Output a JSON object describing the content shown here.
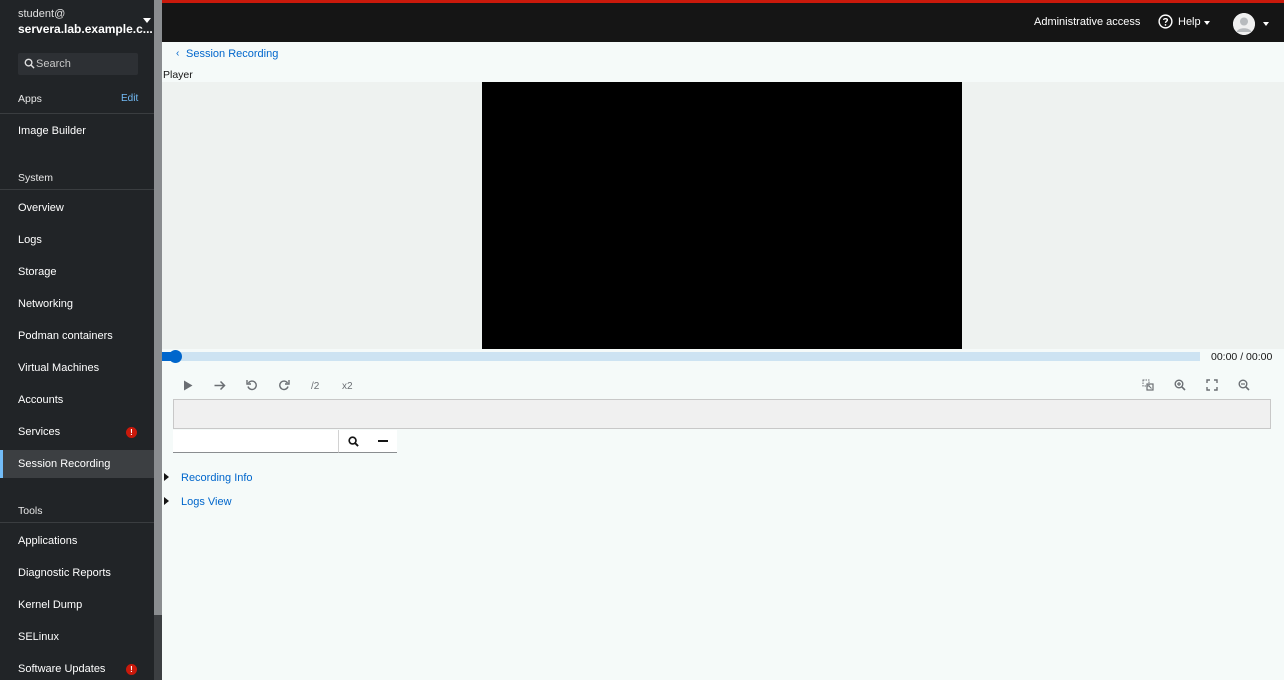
{
  "host": {
    "user": "student@",
    "name": "servera.lab.example.c..."
  },
  "sidebar": {
    "search_placeholder": "Search",
    "apps_header": "Apps",
    "edit_label": "Edit",
    "apps": [
      {
        "label": "Image Builder"
      }
    ],
    "system_header": "System",
    "system": [
      {
        "label": "Overview"
      },
      {
        "label": "Logs"
      },
      {
        "label": "Storage"
      },
      {
        "label": "Networking"
      },
      {
        "label": "Podman containers"
      },
      {
        "label": "Virtual Machines"
      },
      {
        "label": "Accounts"
      },
      {
        "label": "Services",
        "alert": "!"
      },
      {
        "label": "Session Recording",
        "active": true
      }
    ],
    "tools_header": "Tools",
    "tools": [
      {
        "label": "Applications"
      },
      {
        "label": "Diagnostic Reports"
      },
      {
        "label": "Kernel Dump"
      },
      {
        "label": "SELinux"
      },
      {
        "label": "Software Updates",
        "alert": "!"
      }
    ]
  },
  "topbar": {
    "admin_access": "Administrative access",
    "help_label": "Help"
  },
  "main": {
    "breadcrumb": "Session Recording",
    "player_label": "Player",
    "progress_fraction": 0.008,
    "time_readout": "00:00 / 00:00",
    "speed_half": "/2",
    "speed_double": "x2",
    "expanders": [
      {
        "label": "Recording Info"
      },
      {
        "label": "Logs View"
      }
    ]
  },
  "colors": {
    "accent": "#0066cc",
    "link_on_dark": "#73bcf7",
    "alert": "#c9190b",
    "top_border": "#c9190b"
  }
}
